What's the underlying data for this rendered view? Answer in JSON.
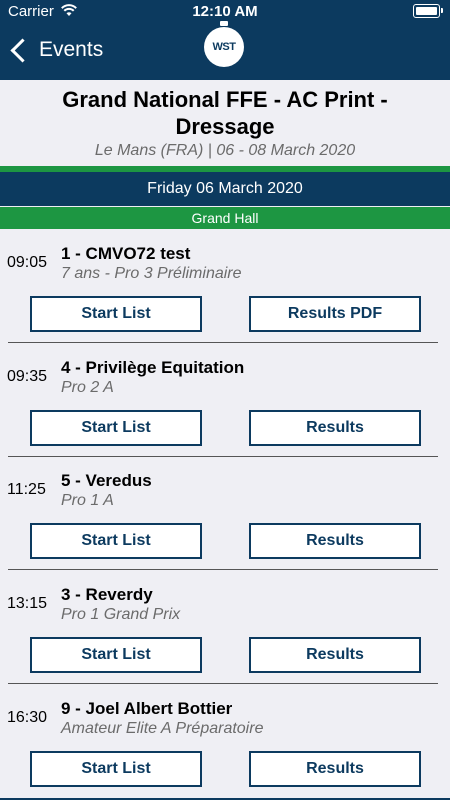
{
  "status_bar": {
    "carrier": "Carrier",
    "time": "12:10 AM"
  },
  "nav": {
    "back_label": "Events",
    "logo_text": "WST"
  },
  "event": {
    "title_line1": "Grand National FFE - AC Print -",
    "title_line2": "Dressage",
    "subtitle": "Le Mans (FRA) | 06 - 08 March 2020"
  },
  "day": {
    "label": "Friday 06 March 2020"
  },
  "hall": {
    "label": "Grand Hall"
  },
  "competitions": [
    {
      "time": "09:05",
      "name": "1 - CMVO72 test",
      "sub": "7 ans - Pro 3 Préliminaire",
      "left_button": "Start List",
      "right_button": "Results PDF"
    },
    {
      "time": "09:35",
      "name": "4 - Privilège Equitation",
      "sub": "Pro 2 A",
      "left_button": "Start List",
      "right_button": "Results"
    },
    {
      "time": "11:25",
      "name": "5 - Veredus",
      "sub": "Pro 1 A",
      "left_button": "Start List",
      "right_button": "Results"
    },
    {
      "time": "13:15",
      "name": "3 - Reverdy",
      "sub": "Pro 1 Grand Prix",
      "left_button": "Start List",
      "right_button": "Results"
    },
    {
      "time": "16:30",
      "name": "9 - Joel Albert Bottier",
      "sub": "Amateur Elite A Préparatoire",
      "left_button": "Start List",
      "right_button": "Results"
    }
  ],
  "colors": {
    "navy": "#0c3a5f",
    "green": "#1d9642",
    "background": "#efeff4"
  },
  "icons": {
    "back": "chevron-left-icon",
    "wifi": "wifi-icon",
    "battery": "battery-icon",
    "logo": "wst-stopwatch-logo"
  }
}
